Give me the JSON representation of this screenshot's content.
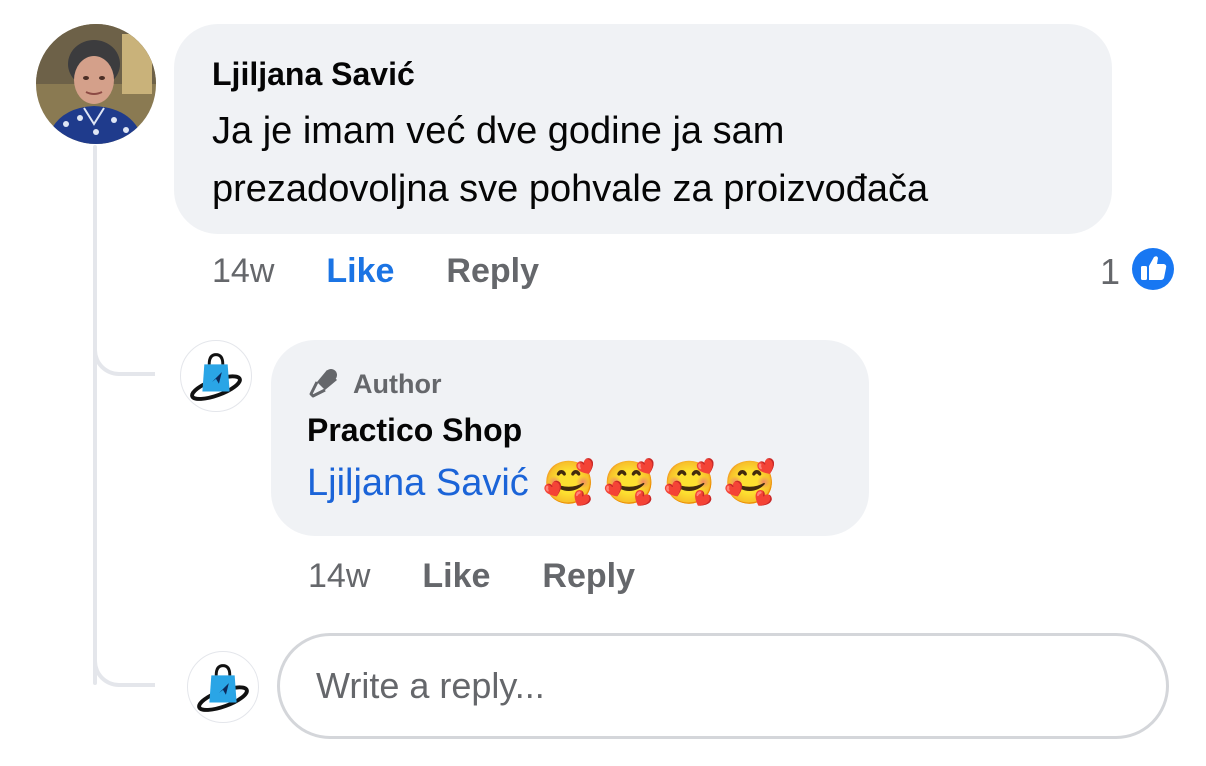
{
  "comment": {
    "author_name": "Ljiljana Savić",
    "text_line1": "Ja je imam već dve godine ja sam",
    "text_line2": "prezadovoljna sve pohvale za proizvođača",
    "time": "14w",
    "like_label": "Like",
    "reply_label": "Reply",
    "reaction_count": "1",
    "reaction_icon": "like-icon",
    "liked_color": "#1b74e4"
  },
  "reply": {
    "badge_label": "Author",
    "badge_icon": "microphone-icon",
    "author_name": "Practico Shop",
    "mention": "Ljiljana Savić",
    "mention_color": "#1b64d8",
    "emojis": [
      "🥰",
      "🥰",
      "🥰",
      "🥰"
    ],
    "time": "14w",
    "like_label": "Like",
    "reply_label": "Reply"
  },
  "composer": {
    "placeholder": "Write a reply..."
  },
  "colors": {
    "bubble_bg": "#f0f2f5",
    "secondary_text": "#65676b",
    "thread_line": "#e4e6eb",
    "brand_blue": "#1877f2"
  }
}
